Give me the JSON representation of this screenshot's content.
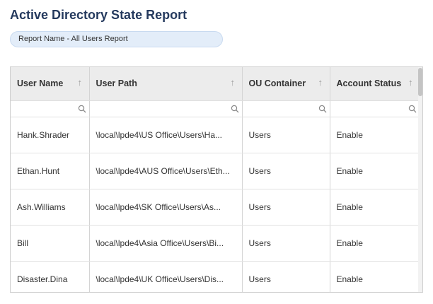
{
  "page": {
    "title": "Active Directory State Report",
    "report_name": "Report Name - All Users Report"
  },
  "table": {
    "columns": [
      {
        "label": "User Name",
        "sort_icon": "arrow-up-icon"
      },
      {
        "label": "User Path",
        "sort_icon": "arrow-up-icon"
      },
      {
        "label": "OU Container",
        "sort_icon": "arrow-up-icon"
      },
      {
        "label": "Account Status",
        "sort_icon": "arrow-up-icon"
      }
    ],
    "filters": [
      "",
      "",
      "",
      ""
    ],
    "rows": [
      {
        "user_name": "Hank.Shrader",
        "user_path": "\\local\\lpde4\\US Office\\Users\\Ha...",
        "ou_container": "Users",
        "account_status": "Enable"
      },
      {
        "user_name": "Ethan.Hunt",
        "user_path": "\\local\\lpde4\\AUS Office\\Users\\Eth...",
        "ou_container": "Users",
        "account_status": "Enable"
      },
      {
        "user_name": "Ash.Williams",
        "user_path": "\\local\\lpde4\\SK Office\\Users\\As...",
        "ou_container": "Users",
        "account_status": "Enable"
      },
      {
        "user_name": "Bill",
        "user_path": "\\local\\lpde4\\Asia Office\\Users\\Bi...",
        "ou_container": "Users",
        "account_status": "Enable"
      },
      {
        "user_name": "Disaster.Dina",
        "user_path": "\\local\\lpde4\\UK Office\\Users\\Dis...",
        "ou_container": "Users",
        "account_status": "Enable"
      }
    ]
  },
  "colors": {
    "title": "#253a5e",
    "pill_background": "#e3edf9",
    "header_background": "#ececec"
  }
}
